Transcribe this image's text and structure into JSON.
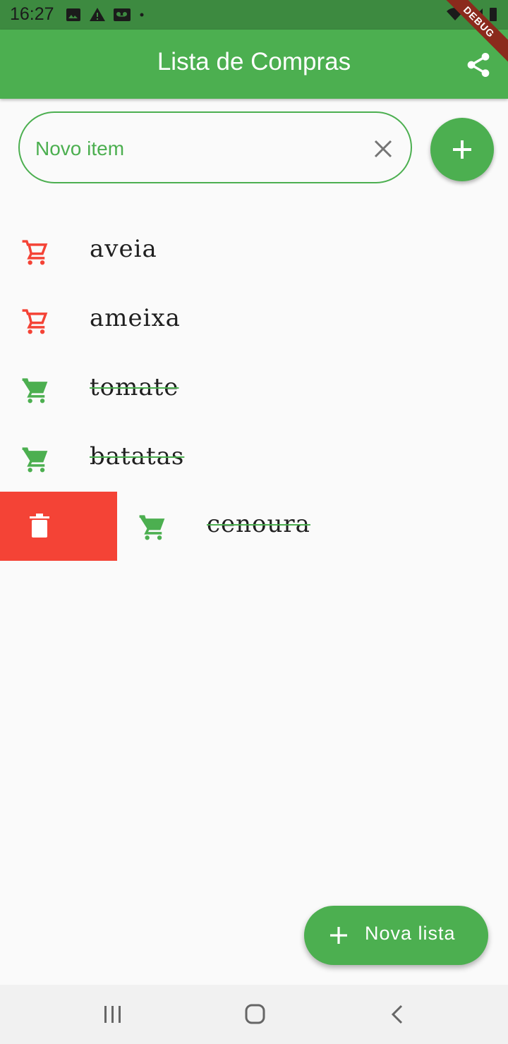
{
  "status_bar": {
    "time": "16:27"
  },
  "debug_banner": "DEBUG",
  "app_bar": {
    "title": "Lista de Compras"
  },
  "new_item": {
    "placeholder": "Novo item"
  },
  "items": [
    {
      "label": "aveia",
      "done": false
    },
    {
      "label": "ameixa",
      "done": false
    },
    {
      "label": "tomate",
      "done": true
    },
    {
      "label": "batatas",
      "done": true
    },
    {
      "label": "cenoura",
      "done": true
    }
  ],
  "fab": {
    "label": "Nova lista"
  },
  "icons": {
    "share": "share-icon",
    "clear": "close-icon",
    "add": "plus-icon",
    "cart": "shopping-cart-icon",
    "delete": "trash-icon"
  },
  "colors": {
    "primary": "#4caf50",
    "status_bar": "#3d8a40",
    "pending_cart": "#f44336",
    "done_cart": "#4caf50",
    "delete_bg": "#f44336"
  }
}
